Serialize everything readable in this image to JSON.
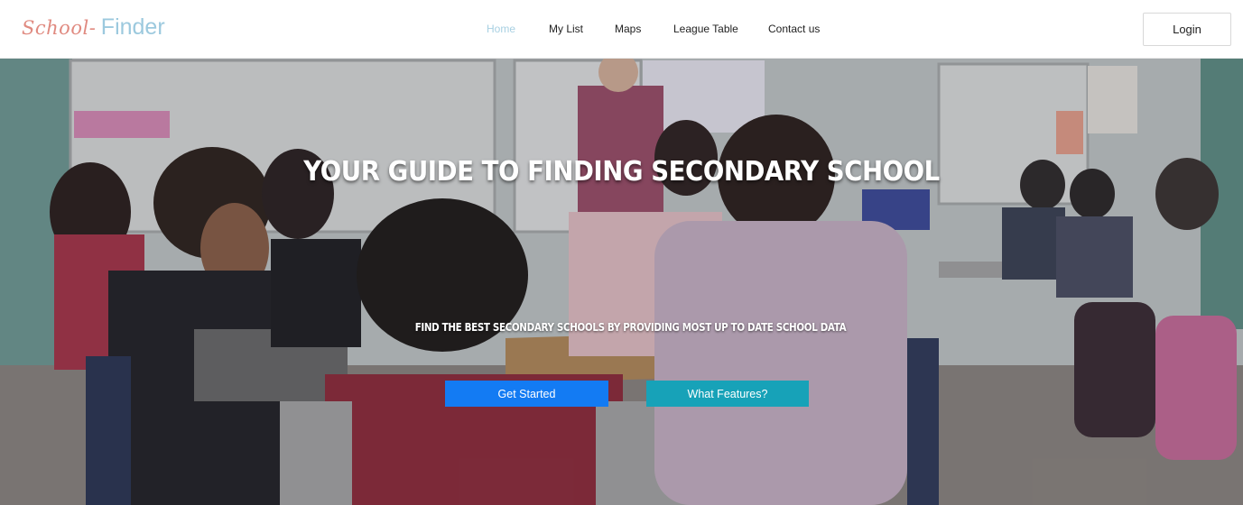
{
  "navbar": {
    "brand": {
      "script": "School",
      "dash": "-",
      "name": "Finder"
    },
    "links": [
      {
        "label": "Home",
        "active": true
      },
      {
        "label": "My List",
        "active": false
      },
      {
        "label": "Maps",
        "active": false
      },
      {
        "label": "League Table",
        "active": false
      },
      {
        "label": "Contact us",
        "active": false
      }
    ],
    "login_label": "Login"
  },
  "hero": {
    "title": "Your Guide to Finding Secondary School",
    "subtitle": "Find the best secondary schools by providing most up to date school data",
    "primary_button": "Get Started",
    "secondary_button": "What Features?"
  },
  "colors": {
    "brand_script": "#e08a80",
    "brand_name": "#9cc9de",
    "active_link": "#a8d0e2",
    "primary_button": "#137bf3",
    "secondary_button": "#17a2b8"
  }
}
